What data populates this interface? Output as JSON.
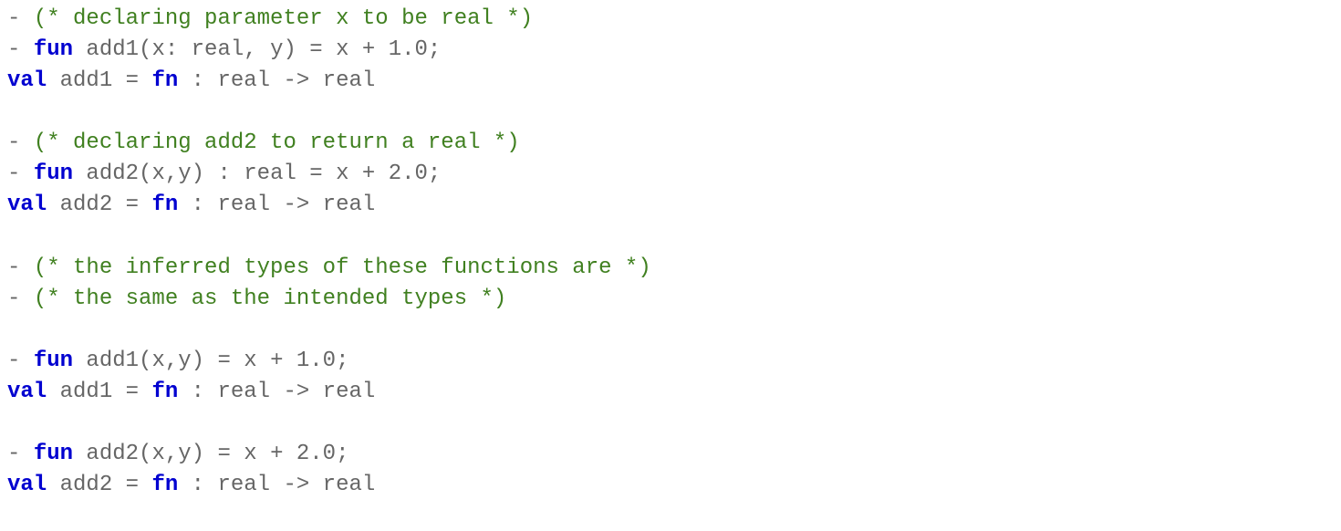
{
  "lines": [
    {
      "tokens": [
        {
          "t": "- ",
          "c": "nm"
        },
        {
          "t": "(* declaring parameter x to be real *)",
          "c": "cm"
        }
      ]
    },
    {
      "tokens": [
        {
          "t": "- ",
          "c": "nm"
        },
        {
          "t": "fun",
          "c": "kw"
        },
        {
          "t": " add1(x: real, y) = x + 1.0;",
          "c": "nm"
        }
      ]
    },
    {
      "tokens": [
        {
          "t": "val",
          "c": "kw"
        },
        {
          "t": " add1 = ",
          "c": "nm"
        },
        {
          "t": "fn",
          "c": "kw"
        },
        {
          "t": " : real -> real",
          "c": "nm"
        }
      ]
    },
    {
      "tokens": [
        {
          "t": " ",
          "c": "nm"
        }
      ]
    },
    {
      "tokens": [
        {
          "t": "- ",
          "c": "nm"
        },
        {
          "t": "(* declaring add2 to return a real *)",
          "c": "cm"
        }
      ]
    },
    {
      "tokens": [
        {
          "t": "- ",
          "c": "nm"
        },
        {
          "t": "fun",
          "c": "kw"
        },
        {
          "t": " add2(x,y) : real = x + 2.0;",
          "c": "nm"
        }
      ]
    },
    {
      "tokens": [
        {
          "t": "val",
          "c": "kw"
        },
        {
          "t": " add2 = ",
          "c": "nm"
        },
        {
          "t": "fn",
          "c": "kw"
        },
        {
          "t": " : real -> real",
          "c": "nm"
        }
      ]
    },
    {
      "tokens": [
        {
          "t": " ",
          "c": "nm"
        }
      ]
    },
    {
      "tokens": [
        {
          "t": "- ",
          "c": "nm"
        },
        {
          "t": "(* the inferred types of these functions are *)",
          "c": "cm"
        }
      ]
    },
    {
      "tokens": [
        {
          "t": "- ",
          "c": "nm"
        },
        {
          "t": "(* the same as the intended types *)",
          "c": "cm"
        }
      ]
    },
    {
      "tokens": [
        {
          "t": " ",
          "c": "nm"
        }
      ]
    },
    {
      "tokens": [
        {
          "t": "- ",
          "c": "nm"
        },
        {
          "t": "fun",
          "c": "kw"
        },
        {
          "t": " add1(x,y) = x + 1.0;",
          "c": "nm"
        }
      ]
    },
    {
      "tokens": [
        {
          "t": "val",
          "c": "kw"
        },
        {
          "t": " add1 = ",
          "c": "nm"
        },
        {
          "t": "fn",
          "c": "kw"
        },
        {
          "t": " : real -> real",
          "c": "nm"
        }
      ]
    },
    {
      "tokens": [
        {
          "t": " ",
          "c": "nm"
        }
      ]
    },
    {
      "tokens": [
        {
          "t": "- ",
          "c": "nm"
        },
        {
          "t": "fun",
          "c": "kw"
        },
        {
          "t": " add2(x,y) = x + 2.0;",
          "c": "nm"
        }
      ]
    },
    {
      "tokens": [
        {
          "t": "val",
          "c": "kw"
        },
        {
          "t": " add2 = ",
          "c": "nm"
        },
        {
          "t": "fn",
          "c": "kw"
        },
        {
          "t": " : real -> real",
          "c": "nm"
        }
      ]
    }
  ]
}
